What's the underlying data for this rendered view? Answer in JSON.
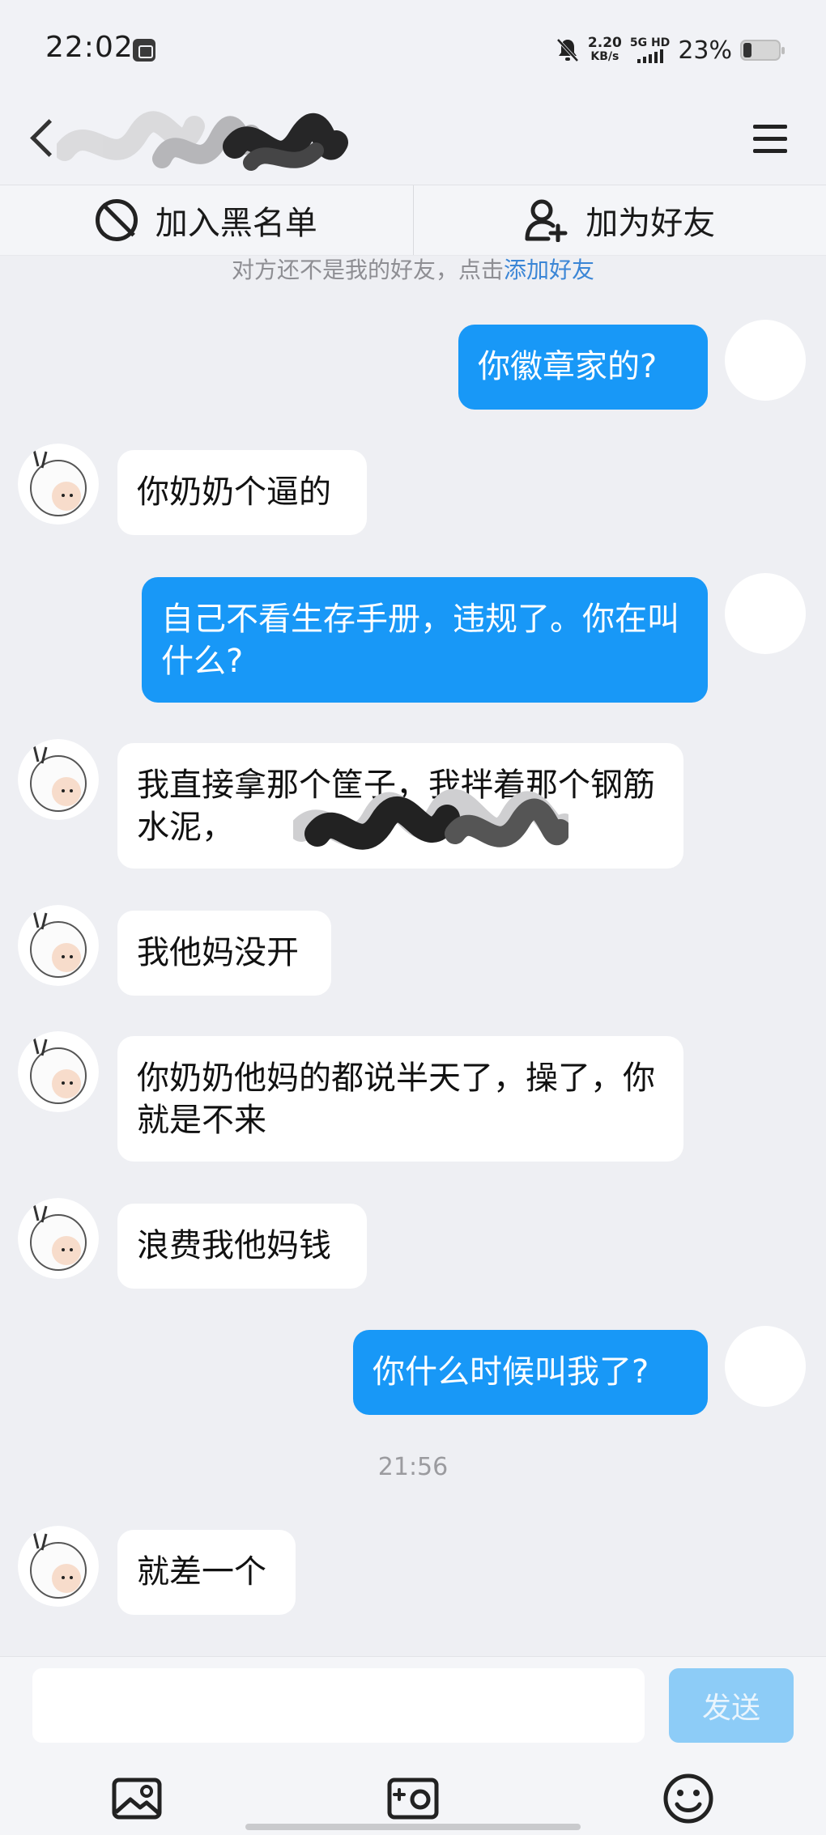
{
  "status_bar": {
    "time": "22:02",
    "net_speed_value": "2.20",
    "net_speed_unit": "KB/s",
    "network": "5G HD",
    "battery_percent": "23%",
    "icons": [
      "screen-record-icon",
      "mute-bell-icon",
      "signal-icon",
      "battery-icon"
    ]
  },
  "header": {
    "back_icon": "chevron-left-icon",
    "menu_icon": "hamburger-menu-icon"
  },
  "actions": {
    "block_label": "加入黑名单",
    "add_friend_label": "加为好友"
  },
  "notice": {
    "text": "对方还不是我的好友，点击",
    "link": "添加好友"
  },
  "messages": [
    {
      "side": "me",
      "text": "你徽章家的?"
    },
    {
      "side": "them",
      "text": "你奶奶个逼的"
    },
    {
      "side": "me",
      "text": "自己不看生存手册，违规了。你在叫什么?"
    },
    {
      "side": "them",
      "text": "我直接拿那个筐子，我拌着那个钢筋水泥，"
    },
    {
      "side": "them",
      "text": "我他妈没开"
    },
    {
      "side": "them",
      "text": "你奶奶他妈的都说半天了，操了，你就是不来"
    },
    {
      "side": "them",
      "text": "浪费我他妈钱"
    },
    {
      "side": "me",
      "text": "你什么时候叫我了?"
    },
    {
      "side": "them",
      "text": "就差一个"
    }
  ],
  "timestamp": "21:56",
  "composer": {
    "placeholder": "",
    "send_label": "发送",
    "tools": [
      "image-icon",
      "camera-icon",
      "emoji-icon"
    ]
  },
  "colors": {
    "my_bubble": "#1898f7",
    "their_bubble": "#ffffff",
    "background": "#eeeff3",
    "link": "#3b86d6",
    "send_disabled": "#8dccf7"
  }
}
